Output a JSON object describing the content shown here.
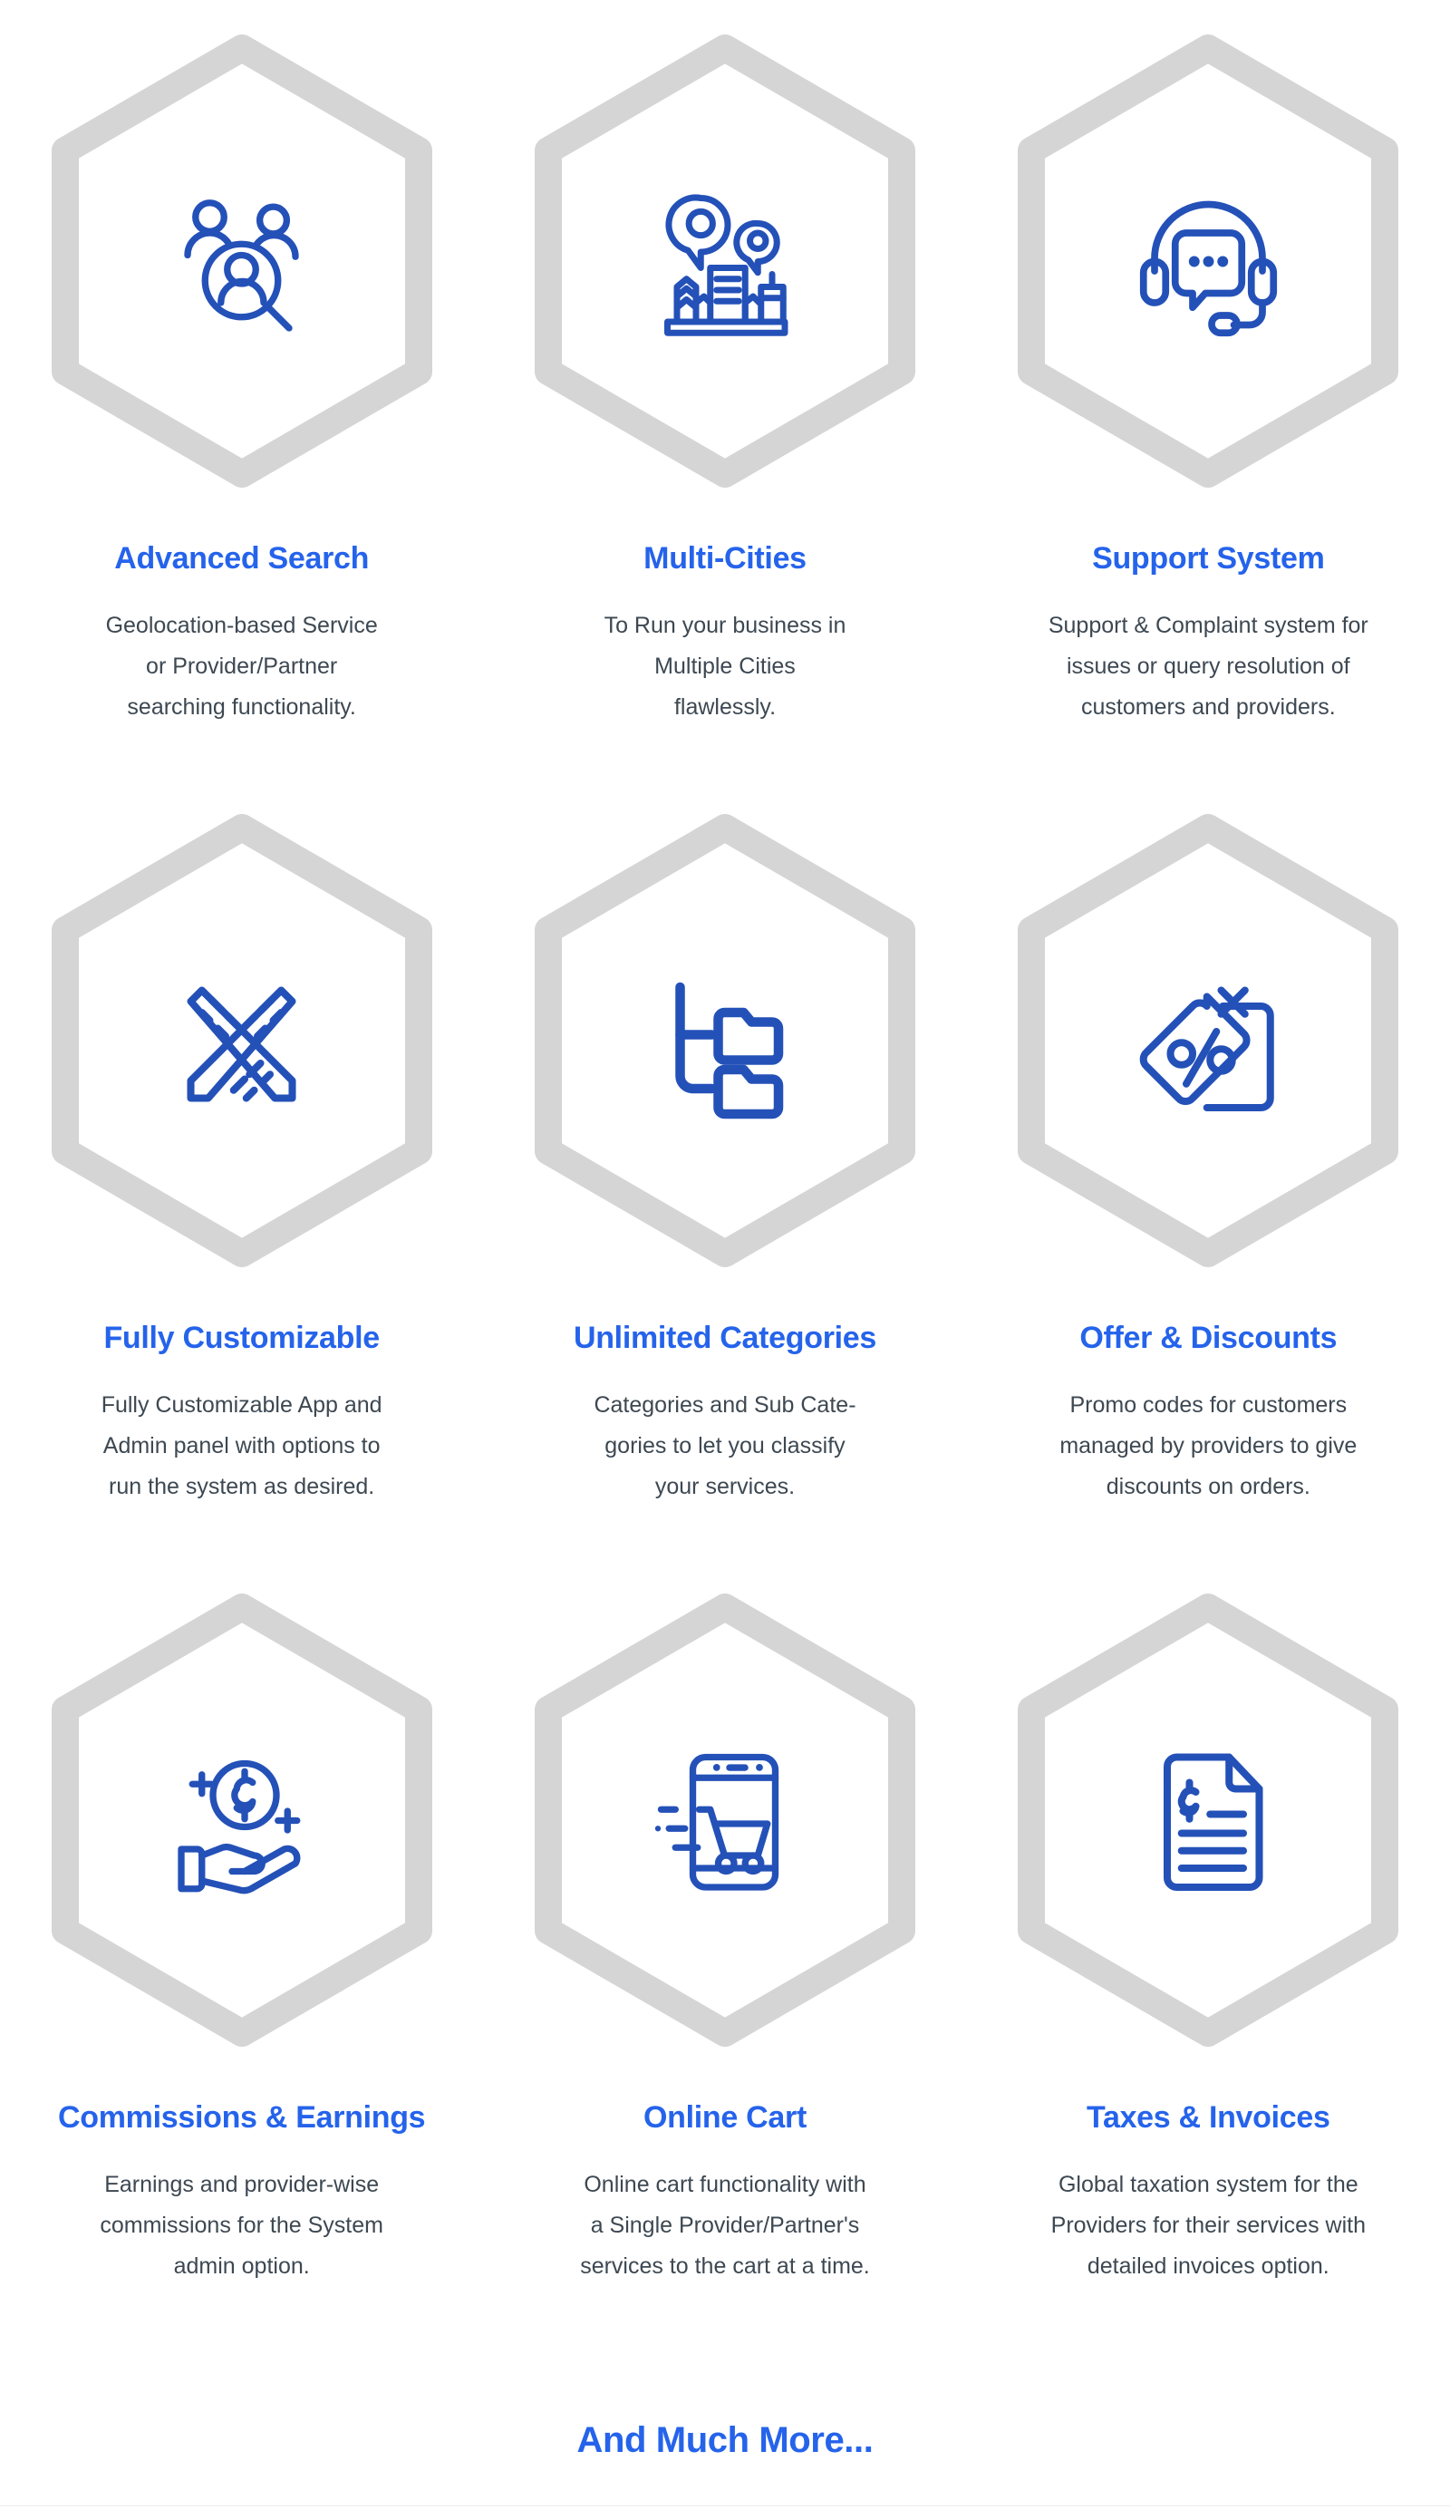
{
  "accent_color": "#2563eb",
  "hex_color": "#d5d5d5",
  "body_text_color": "#3d4852",
  "background_color": "#ffffff",
  "features": [
    {
      "icon": "user-search-icon",
      "title": "Advanced Search",
      "desc_lines": [
        "Geolocation-based Service",
        "or Provider/Partner",
        "searching functionality."
      ]
    },
    {
      "icon": "city-map-pins-icon",
      "title": "Multi-Cities",
      "desc_lines": [
        "To Run your business in",
        "Multiple Cities",
        "flawlessly."
      ]
    },
    {
      "icon": "headset-chat-icon",
      "title": "Support System",
      "desc_lines": [
        "Support & Complaint system for",
        "issues or query resolution of",
        "customers and providers."
      ]
    },
    {
      "icon": "pencil-ruler-icon",
      "title": "Fully Customizable",
      "desc_lines": [
        "Fully Customizable App and",
        "Admin panel with options to",
        "run the system as desired."
      ]
    },
    {
      "icon": "folder-tree-icon",
      "title": "Unlimited Categories",
      "desc_lines": [
        "Categories and Sub Cate-",
        "gories to let you classify",
        "your services."
      ]
    },
    {
      "icon": "discount-tag-icon",
      "title": "Offer & Discounts",
      "desc_lines": [
        "Promo codes for customers",
        "managed by providers to give",
        "discounts on orders."
      ]
    },
    {
      "icon": "hand-coin-icon",
      "title": "Commissions & Earnings",
      "desc_lines": [
        "Earnings and provider-wise",
        "commissions for the System",
        "admin option."
      ]
    },
    {
      "icon": "mobile-cart-icon",
      "title": "Online Cart",
      "desc_lines": [
        "Online cart functionality with",
        "a Single Provider/Partner's",
        "services to the cart at a time."
      ]
    },
    {
      "icon": "invoice-document-icon",
      "title": "Taxes & Invoices",
      "desc_lines": [
        "Global taxation system for the",
        "Providers for their services with",
        "detailed invoices option."
      ]
    }
  ],
  "footer": {
    "more_label": "And Much More..."
  }
}
